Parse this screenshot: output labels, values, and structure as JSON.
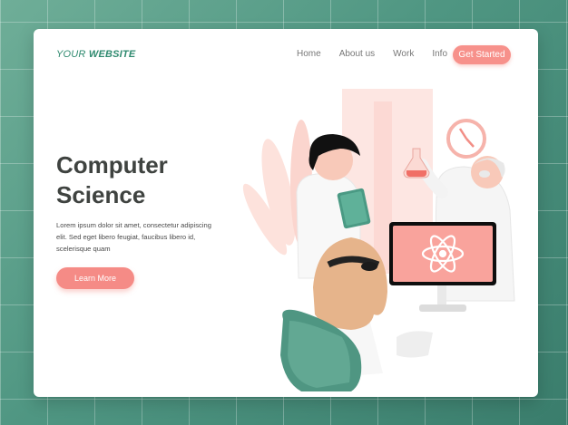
{
  "brand": {
    "prefix": "YOUR",
    "suffix": "WEBSITE"
  },
  "nav": {
    "items": [
      "Home",
      "About us",
      "Work",
      "Info"
    ],
    "cta": "Get Started"
  },
  "hero": {
    "title_line1": "Computer",
    "title_line2": "Science",
    "description": "Lorem ipsum dolor sit amet, consectetur adipiscing elit. Sed eget libero feugiat, faucibus libero id, scelerisque quam",
    "button": "Learn More"
  },
  "icons": {
    "monitor": "atom-icon",
    "wall": "clock-icon",
    "flask": "flask-icon"
  },
  "colors": {
    "accent": "#f58b86",
    "brand_green": "#2f8a6f",
    "background": "#4f9682"
  }
}
